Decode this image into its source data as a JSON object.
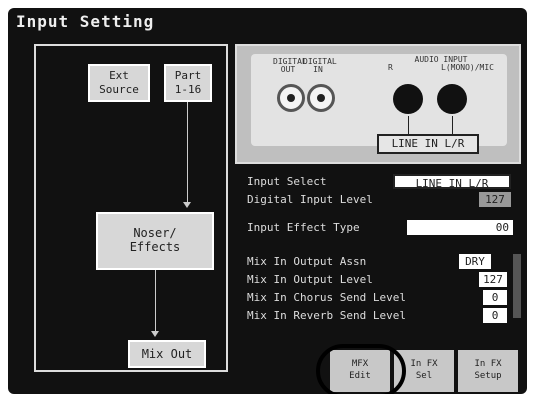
{
  "window": {
    "title": "Input Setting"
  },
  "routing": {
    "ext_source": "Ext\nSource",
    "part": "Part\n1-16",
    "effects": "Noser/\nEffects",
    "mix_out": "Mix Out"
  },
  "jacks": {
    "digital_labels": [
      "DIGITAL\nOUT",
      "DIGITAL\nIN"
    ],
    "audio_label": "AUDIO INPUT\nR          L(MONO)/MIC",
    "line_in": "LINE IN L/R"
  },
  "params": {
    "input_select": {
      "label": "Input Select",
      "value": "LINE IN L/R"
    },
    "digital_input_level": {
      "label": "Digital Input Level",
      "value": "127"
    },
    "input_effect_type": {
      "label": "Input Effect Type",
      "value": "00"
    },
    "mix_in_output_assign": {
      "label": "Mix In Output Assn",
      "value": "DRY"
    },
    "mix_in_output_level": {
      "label": "Mix In Output Level",
      "value": "127"
    },
    "mix_in_chorus_send": {
      "label": "Mix In Chorus Send Level",
      "value": "0"
    },
    "mix_in_reverb_send": {
      "label": "Mix In Reverb Send Level",
      "value": "0"
    }
  },
  "tabs": [
    {
      "label": "MFX\nEdit"
    },
    {
      "label": "In FX\nSel"
    },
    {
      "label": "In FX\nSetup"
    }
  ]
}
